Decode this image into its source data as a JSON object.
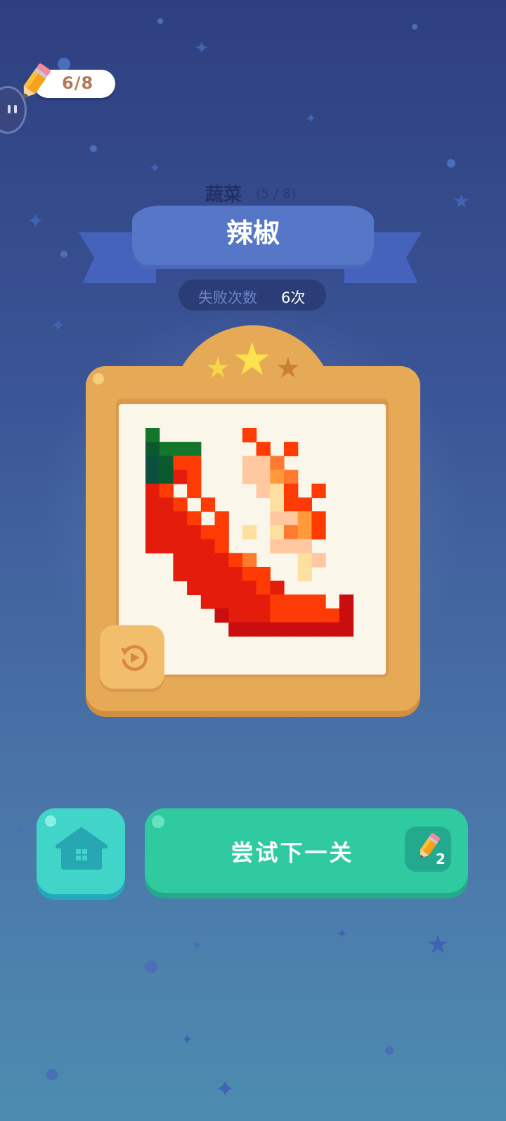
{
  "hud": {
    "pencil_count": "6/8",
    "pause_icon": "pause-icon"
  },
  "header": {
    "category": "蔬菜",
    "progress": "(5 / 8)",
    "level_name": "辣椒"
  },
  "stats": {
    "fail_label": "失败次数",
    "fail_value": "6次"
  },
  "rating": {
    "stars_earned": 2,
    "stars_total": 3
  },
  "buttons": {
    "replay_icon": "replay-icon",
    "home_icon": "home-icon",
    "next_label": "尝试下一关",
    "next_cost": "2"
  },
  "colors": {
    "card": "#e6a955",
    "next_button": "#2fcaa0",
    "home_button": "#41d5ca",
    "star_filled": "#fde24d",
    "star_empty": "#c98035"
  },
  "pixel_art": {
    "cols": 16,
    "rows": 16,
    "palette": {
      "G": "#13762a",
      "D": "#0b5a2e",
      "E": "#0d4f3e",
      "R": "#ff3b05",
      "r": "#e41c0c",
      "k": "#c80e0e",
      "o": "#ff7a2e",
      "O": "#ff9a3a",
      "p": "#ffc8a0",
      "y": "#fde0a0",
      "w": "#fbf6ea"
    },
    "grid": [
      "G......R........",
      "DGGG....R.R.....",
      "EDRR...ppo......",
      "EDrR...ppOo.....",
      "rR.R....pyR.R...",
      "rrR.R....yRR....",
      "rrrR.R...ppOR...",
      "rrrrRR.y.yoOR...",
      "rrrrrR...ppp....",
      "..rrrrRo...yp...",
      "..rrrrrRR..y....",
      "...rrrrrRr......",
      "....rrrrrRRRR.k.",
      ".....krrrRRRRRk.",
      "......kkkkkkkkk.",
      "................"
    ]
  }
}
